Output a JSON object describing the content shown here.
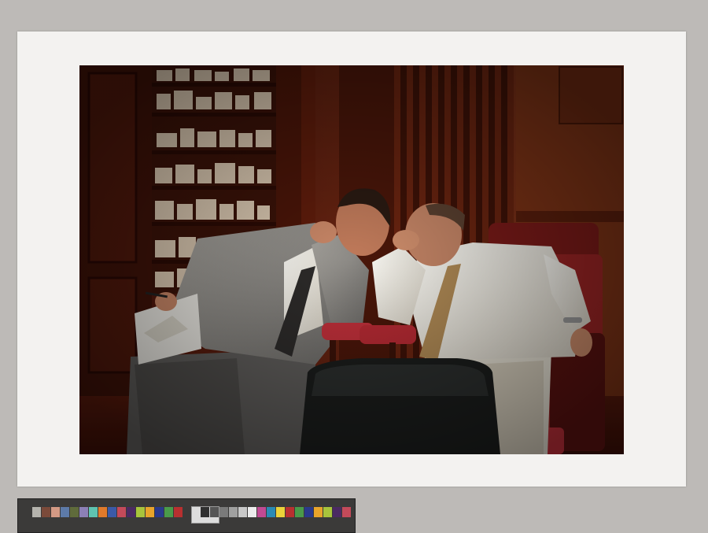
{
  "scene": {
    "description_hidden": "",
    "colors": {
      "background": "#bdbab7",
      "mat": "#f3f2f0",
      "wood_dark": "#3a1008",
      "wood_mid": "#6a2410",
      "wall": "#7a2e15",
      "shirt": "#f0efe9",
      "suit_gray": "#8b8986",
      "leather_red": "#c0303a",
      "chair_black": "#1b1d1c"
    }
  },
  "color_target": {
    "swatches_left": [
      "#b5b3ad",
      "#7b4a3a",
      "#d49a85",
      "#5d7aa8",
      "#5f6b3b",
      "#8c80b6",
      "#5fc3b0",
      "#e07a2b",
      "#3b5aa8",
      "#c44a5a",
      "#4b2a63",
      "#a8c43c",
      "#e8a42b",
      "#2a3a8c",
      "#4a9a4a",
      "#b83030",
      "#ebd23a",
      "#c04a93",
      "#2a8ab4",
      "#ececec",
      "#c8c8c8",
      "#a0a0a0",
      "#7a7a7a",
      "#555555",
      "#303030"
    ],
    "swatches_right": [
      "#303030",
      "#555555",
      "#7a7a7a",
      "#a0a0a0",
      "#c8c8c8",
      "#ececec",
      "#c04a93",
      "#2a8ab4",
      "#ebd23a",
      "#b83030",
      "#4a9a4a",
      "#2a3a8c",
      "#e8a42b",
      "#a8c43c",
      "#4b2a63",
      "#c44a5a"
    ]
  }
}
